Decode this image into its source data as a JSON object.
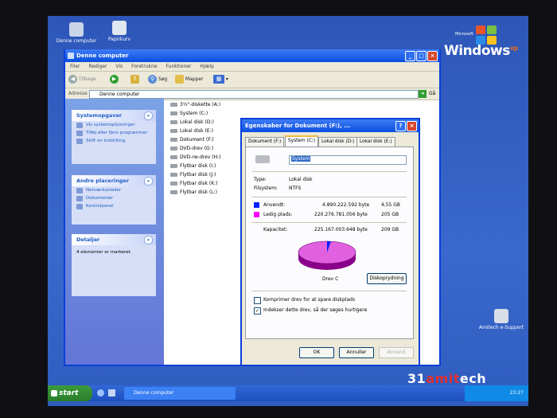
{
  "desktop": {
    "icons": [
      {
        "label": "Denne computer"
      },
      {
        "label": "Papirkurv"
      },
      {
        "label": "Amitech e-Support"
      }
    ],
    "os_logo": {
      "microsoft": "Microsoft",
      "windows": "Windows",
      "xp": "xp"
    }
  },
  "explorer": {
    "title": "Denne computer",
    "menu": [
      "Filer",
      "Rediger",
      "Vis",
      "Foretrukne",
      "Funktioner",
      "Hjælp"
    ],
    "toolbar": {
      "back": "Tilbage",
      "search": "Søg",
      "folders": "Mapper"
    },
    "address": {
      "label": "Adresse",
      "value": "Denne computer",
      "go": "Gå"
    },
    "panels": [
      {
        "title": "Systemopgaver",
        "items": [
          "Vis systemoplysninger",
          "Tilføj eller fjern programmer",
          "Skift en indstilling"
        ]
      },
      {
        "title": "Andre placeringer",
        "items": [
          "Netværkssteder",
          "Dokumenter",
          "Kontrolpanel"
        ]
      },
      {
        "title": "Detaljer",
        "text": "4 elementer er markeret."
      }
    ],
    "drives": [
      "3½\"-diskette (A:)",
      "System (C:)",
      "Lokal disk (D:)",
      "Lokal disk (E:)",
      "Dokument (F:)",
      "DVD-drev (G:)",
      "DVD-rw-drev (H:)",
      "Flytbar disk (I:)",
      "Flytbar disk (J:)",
      "Flytbar disk (K:)",
      "Flytbar disk (L:)"
    ]
  },
  "dialog": {
    "title": "Egenskaber for Dokument (F:), ...",
    "tabs": [
      "Dokument (F:)",
      "System (C:)",
      "Lokal disk (D:)",
      "Lokal disk (E:)"
    ],
    "active_tab": "System (C:)",
    "name_field": "System",
    "type_label": "Type:",
    "type_value": "Lokal disk",
    "fs_label": "Filsystem:",
    "fs_value": "NTFS",
    "used_label": "Anvendt:",
    "used_bytes": "4.890.222.592 byte",
    "used_gb": "4,55 GB",
    "free_label": "Ledig plads:",
    "free_bytes": "220.276.781.056 byte",
    "free_gb": "205 GB",
    "cap_label": "Kapacitet:",
    "cap_bytes": "225.167.003.648 byte",
    "cap_gb": "209 GB",
    "drive_caption": "Drev C",
    "cleanup": "Diskoprydning",
    "compress": "Komprimer drev for at spare diskplads",
    "index": "Indekser dette drev, så der søges hurtigere",
    "ok": "OK",
    "cancel": "Annuller",
    "apply": "Anvend",
    "used_fraction": 0.0217,
    "colors": {
      "used": "#0020ff",
      "free": "#ff00ff"
    }
  },
  "taskbar": {
    "start": "start",
    "task": "Denne computer",
    "clock": "23:27"
  },
  "watermark": {
    "a": "31",
    "b": "am",
    "c": "it",
    "d": "ech"
  }
}
